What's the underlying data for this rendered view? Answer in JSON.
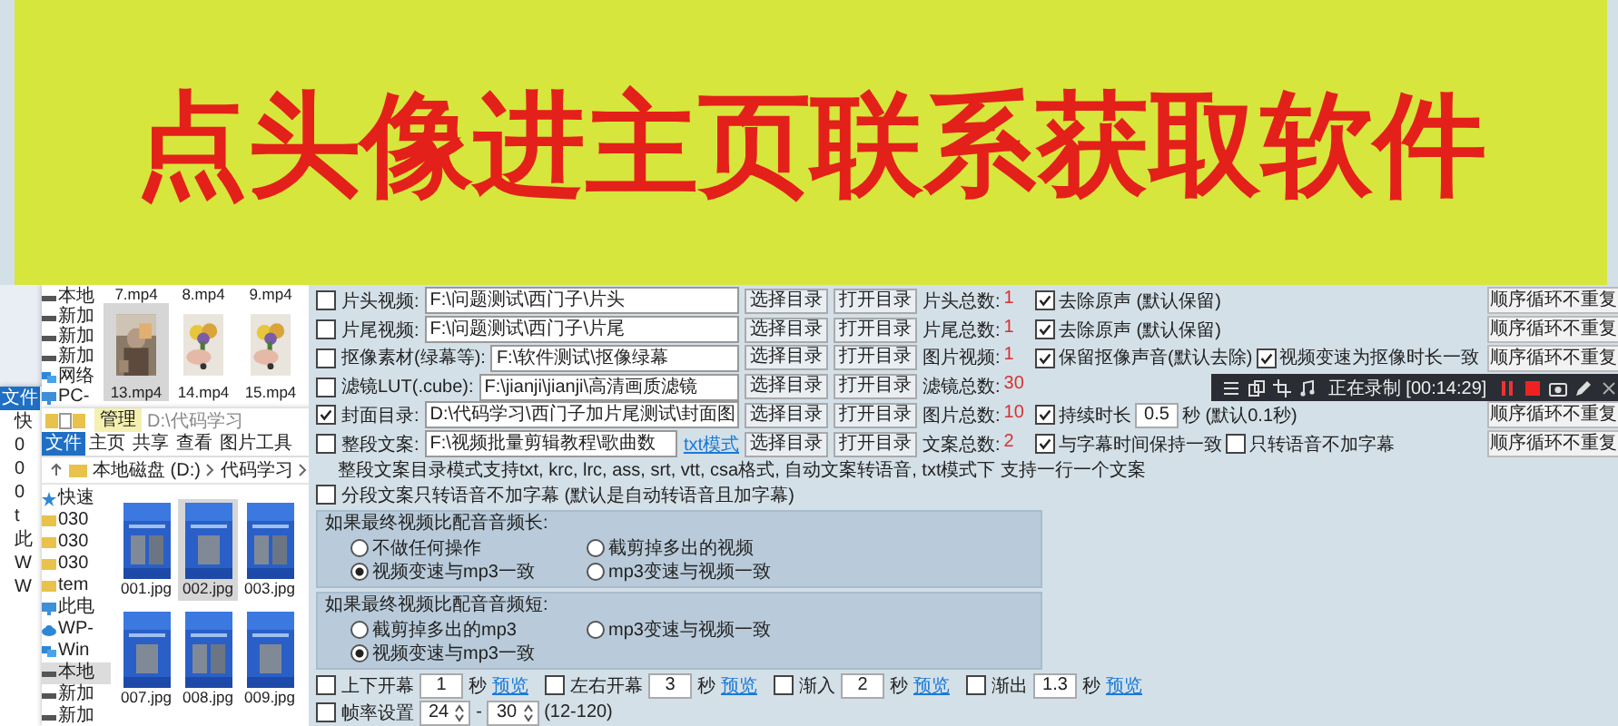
{
  "banner": {
    "text": "点头像进主页联系获取软件"
  },
  "explorer_left": {
    "tab": "文件",
    "sidebar": [
      "快",
      "0",
      "0",
      "0",
      "t",
      "此",
      "W",
      "W"
    ]
  },
  "explorer_back": {
    "sidebar": [
      {
        "label": "本地",
        "kind": "drive"
      },
      {
        "label": "新加",
        "kind": "drive"
      },
      {
        "label": "新加",
        "kind": "drive"
      },
      {
        "label": "新加",
        "kind": "drive"
      },
      {
        "label": "网络",
        "kind": "network"
      },
      {
        "label": "PC-",
        "kind": "pc"
      }
    ],
    "captions": [
      "7.mp4",
      "8.mp4",
      "9.mp4"
    ],
    "files": [
      {
        "name": "13.mp4",
        "selected": true
      },
      {
        "name": "14.mp4",
        "selected": false
      },
      {
        "name": "15.mp4",
        "selected": false
      }
    ]
  },
  "explorer_front": {
    "context_tab": "管理",
    "title": "D:\\代码学习",
    "ribbon_tabs": [
      {
        "label": "文件",
        "selected": true
      },
      {
        "label": "主页",
        "selected": false
      },
      {
        "label": "共享",
        "selected": false
      },
      {
        "label": "查看",
        "selected": false
      },
      {
        "label": "图片工具",
        "selected": false
      }
    ],
    "breadcrumbs": [
      "本地磁盘 (D:)",
      "代码学习"
    ],
    "sidebar": [
      {
        "label": "快速",
        "kind": "star",
        "selected": false
      },
      {
        "label": "030",
        "kind": "folder",
        "selected": false
      },
      {
        "label": "030",
        "kind": "folder",
        "selected": false
      },
      {
        "label": "030",
        "kind": "folder",
        "selected": false
      },
      {
        "label": "tem",
        "kind": "folder",
        "selected": false
      },
      {
        "label": "此电",
        "kind": "pc",
        "selected": false
      },
      {
        "label": "WP-",
        "kind": "cloud",
        "selected": false
      },
      {
        "label": "Win",
        "kind": "network",
        "selected": false
      },
      {
        "label": "本地",
        "kind": "drive",
        "selected": true
      },
      {
        "label": "新加",
        "kind": "drive",
        "selected": false
      },
      {
        "label": "新加",
        "kind": "drive",
        "selected": false
      }
    ],
    "files": [
      {
        "name": "001.jpg",
        "selected": false
      },
      {
        "name": "002.jpg",
        "selected": true
      },
      {
        "name": "003.jpg",
        "selected": false
      },
      {
        "name": "007.jpg",
        "selected": false
      },
      {
        "name": "008.jpg",
        "selected": false
      },
      {
        "name": "009.jpg",
        "selected": false
      }
    ]
  },
  "form": {
    "rows": [
      {
        "label": "片头视频:",
        "checked": false,
        "path": "F:\\问题测试\\西门子\\片头",
        "buttons": [
          "选择目录",
          "打开目录"
        ],
        "count_label": "片头总数:",
        "count": "1",
        "options": [
          {
            "kind": "checkbox",
            "label": "去除原声 (默认保留)",
            "checked": true
          }
        ],
        "dropdown": "顺序循环不重复"
      },
      {
        "label": "片尾视频:",
        "checked": false,
        "path": "F:\\问题测试\\西门子\\片尾",
        "buttons": [
          "选择目录",
          "打开目录"
        ],
        "count_label": "片尾总数:",
        "count": "1",
        "options": [
          {
            "kind": "checkbox",
            "label": "去除原声 (默认保留)",
            "checked": true
          }
        ],
        "dropdown": "顺序循环不重复"
      },
      {
        "label": "抠像素材(绿幕等):",
        "checked": false,
        "path": "F:\\软件测试\\抠像绿幕",
        "buttons": [
          "选择目录",
          "打开目录"
        ],
        "count_label": "图片视频:",
        "count": "1",
        "options": [
          {
            "kind": "checkbox",
            "label": "保留抠像声音(默认去除)",
            "checked": true
          },
          {
            "kind": "checkbox",
            "label": "视频变速为抠像时长一致",
            "checked": true
          }
        ],
        "dropdown": "顺序循环不重复"
      },
      {
        "label": "滤镜LUT(.cube):",
        "checked": false,
        "path": "F:\\jianji\\jianji\\高清画质滤镜",
        "buttons": [
          "选择目录",
          "打开目录"
        ],
        "count_label": "滤镜总数:",
        "count": "30"
      },
      {
        "label": "封面目录:",
        "checked": true,
        "path": "D:\\代码学习\\西门子加片尾测试\\封面图",
        "buttons": [
          "选择目录",
          "打开目录"
        ],
        "count_label": "图片总数:",
        "count": "10",
        "options": [
          {
            "kind": "duration",
            "label": "持续时长",
            "checked": true,
            "value": "0.5",
            "note": "秒 (默认0.1秒)"
          }
        ],
        "dropdown": "顺序循环不重复"
      },
      {
        "label": "整段文案:",
        "checked": false,
        "path": "F:\\视频批量剪辑教程\\歌曲数",
        "link": "txt模式",
        "buttons": [
          "选择目录",
          "打开目录"
        ],
        "count_label": "文案总数:",
        "count": "2",
        "options": [
          {
            "kind": "checkbox",
            "label": "与字幕时间保持一致",
            "checked": true
          },
          {
            "kind": "checkbox",
            "label": "只转语音不加字幕",
            "checked": false
          }
        ],
        "dropdown": "顺序循环不重复"
      }
    ],
    "note": "整段文案目录模式支持txt, krc, lrc, ass, srt, vtt, csa格式, 自动文案转语音, txt模式下 支持一行一个文案",
    "segment": {
      "label": "分段文案只转语音不加字幕 (默认是自动转语音且加字幕)",
      "checked": false
    },
    "groups": [
      {
        "title": "如果最终视频比配音音频长:",
        "radios": [
          {
            "label": "不做任何操作",
            "selected": false
          },
          {
            "label": "截剪掉多出的视频",
            "selected": false
          },
          {
            "label": "视频变速与mp3一致",
            "selected": true
          },
          {
            "label": "mp3变速与视频一致",
            "selected": false
          }
        ]
      },
      {
        "title": "如果最终视频比配音音频短:",
        "radios": [
          {
            "label": "截剪掉多出的mp3",
            "selected": false
          },
          {
            "label": "mp3变速与视频一致",
            "selected": false
          },
          {
            "label": "视频变速与mp3一致",
            "selected": true
          }
        ]
      }
    ],
    "effects": [
      {
        "label": "上下开幕",
        "checked": false,
        "value": "1",
        "unit": "秒",
        "link": "预览"
      },
      {
        "label": "左右开幕",
        "checked": false,
        "value": "3",
        "unit": "秒",
        "link": "预览"
      },
      {
        "label": "渐入",
        "checked": false,
        "value": "2",
        "unit": "秒",
        "link": "预览"
      },
      {
        "label": "渐出",
        "checked": false,
        "value": "1.3",
        "unit": "秒",
        "link": "预览"
      }
    ],
    "frame_rate": {
      "label": "帧率设置",
      "checked": false,
      "min": "24",
      "separator": "-",
      "max": "30",
      "range": "(12-120)"
    }
  },
  "recorder": {
    "status": "正在录制 [00:14:29]"
  }
}
